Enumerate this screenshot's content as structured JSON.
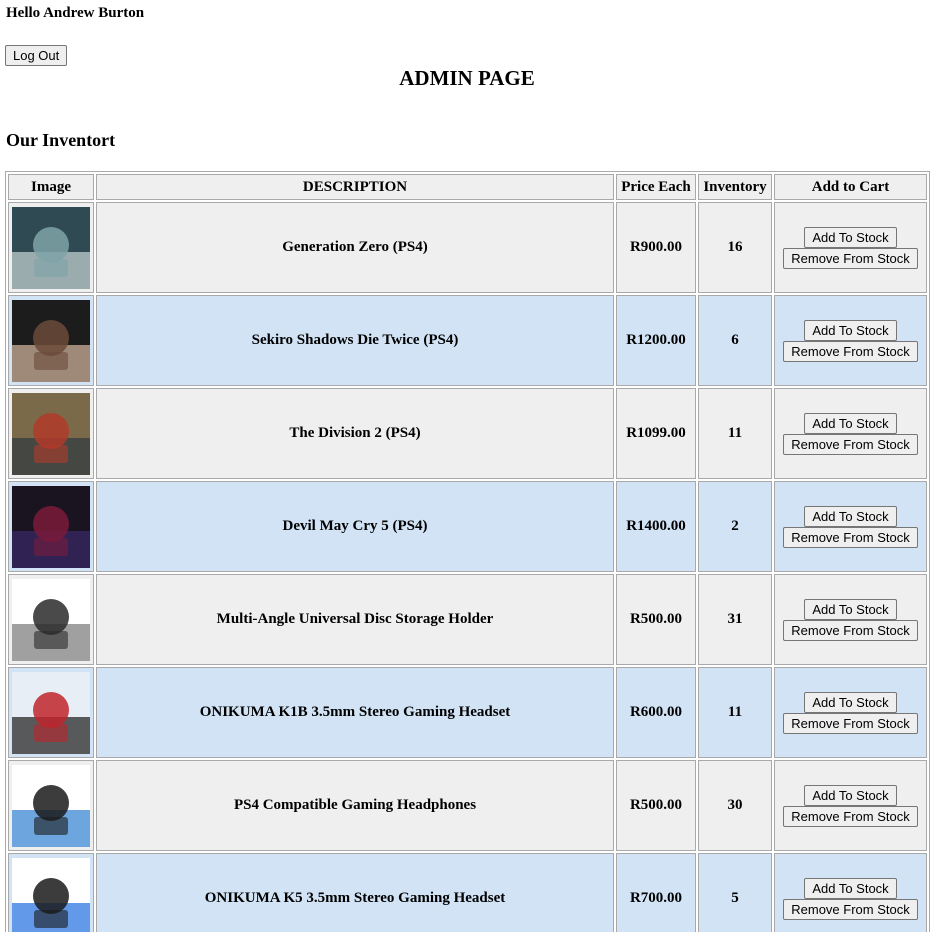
{
  "header": {
    "greeting": "Hello Andrew Burton",
    "logout_label": "Log Out",
    "page_title": "ADMIN PAGE",
    "section_title": "Our Inventort"
  },
  "table": {
    "columns": [
      "Image",
      "DESCRIPTION",
      "Price Each",
      "Inventory",
      "Add to Cart"
    ],
    "add_label": "Add To Stock",
    "remove_label": "Remove From Stock",
    "rows": [
      {
        "description": "Generation Zero (PS4)",
        "price": "R900.00",
        "inventory": "16",
        "image": "generation-zero-cover"
      },
      {
        "description": "Sekiro Shadows Die Twice (PS4)",
        "price": "R1200.00",
        "inventory": "6",
        "image": "sekiro-cover"
      },
      {
        "description": "The Division 2 (PS4)",
        "price": "R1099.00",
        "inventory": "11",
        "image": "division-2-cover"
      },
      {
        "description": "Devil May Cry 5 (PS4)",
        "price": "R1400.00",
        "inventory": "2",
        "image": "devil-may-cry-5-cover"
      },
      {
        "description": "Multi-Angle Universal Disc Storage Holder",
        "price": "R500.00",
        "inventory": "31",
        "image": "disc-holder-photo"
      },
      {
        "description": "ONIKUMA K1B 3.5mm Stereo Gaming Headset",
        "price": "R600.00",
        "inventory": "11",
        "image": "red-headset-photo"
      },
      {
        "description": "PS4 Compatible Gaming Headphones",
        "price": "R500.00",
        "inventory": "30",
        "image": "blue-headphones-photo"
      },
      {
        "description": "ONIKUMA K5 3.5mm Stereo Gaming Headset",
        "price": "R700.00",
        "inventory": "5",
        "image": "blue-headset-photo"
      }
    ]
  }
}
